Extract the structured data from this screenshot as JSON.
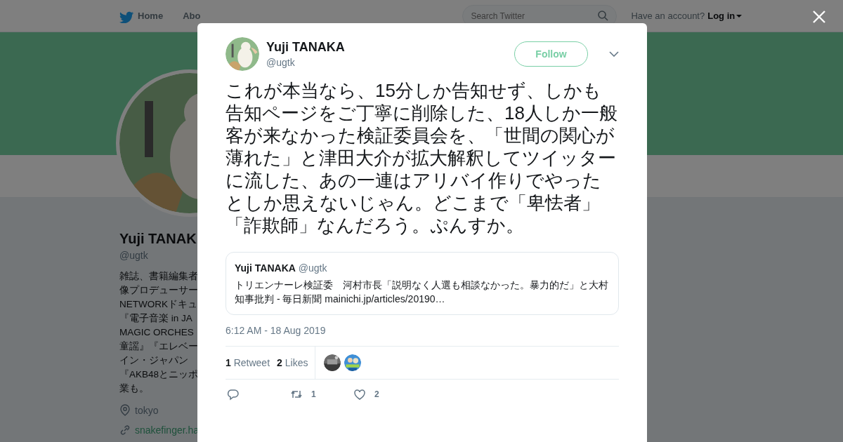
{
  "nav": {
    "items": [
      "Home",
      "Abo"
    ],
    "search": {
      "placeholder": "Search Twitter"
    },
    "account_prompt": "Have an account?",
    "login": "Log in"
  },
  "profile": {
    "name": "Yuji TANAK",
    "handle": "@ugtk",
    "bio_lines": [
      "雑誌、書籍編集者",
      "像プロデューサー",
      "NETWORKドキュ",
      "『電子音楽 in JA",
      "MAGIC ORCHES",
      "童謡』『エレベー",
      "イン・ジャパン",
      "『AKB48とニッポ",
      "業も。"
    ],
    "location": "tokyo",
    "url": "snakefinger.ha"
  },
  "tweet": {
    "name": "Yuji TANAKA",
    "handle": "@ugtk",
    "follow": "Follow",
    "text": "これが本当なら、15分しか告知せず、しかも告知ページをご丁寧に削除した、18人しか一般客が来なかった検証委員会を、「世間の関心が薄れた」と津田大介が拡大解釈してツイッターに流した、あの一連はアリバイ作りでやったとしか思えないじゃん。どこまで「卑怯者」「詐欺師」なんだろう。ぷんすか。",
    "quote": {
      "name": "Yuji TANAKA",
      "handle": "@ugtk",
      "text": "トリエンナーレ検証委　河村市長「説明なく人選も相談なかった。暴力的だ」と大村知事批判 - 毎日新聞 mainichi.jp/articles/20190…"
    },
    "time": "6:12 AM - 18 Aug 2019",
    "stats": [
      {
        "count": "1",
        "label": "Retweet"
      },
      {
        "count": "2",
        "label": "Likes"
      }
    ],
    "actions": [
      {
        "kind": "reply"
      },
      {
        "kind": "retweet",
        "count": "1"
      },
      {
        "kind": "like",
        "count": "2"
      }
    ]
  }
}
